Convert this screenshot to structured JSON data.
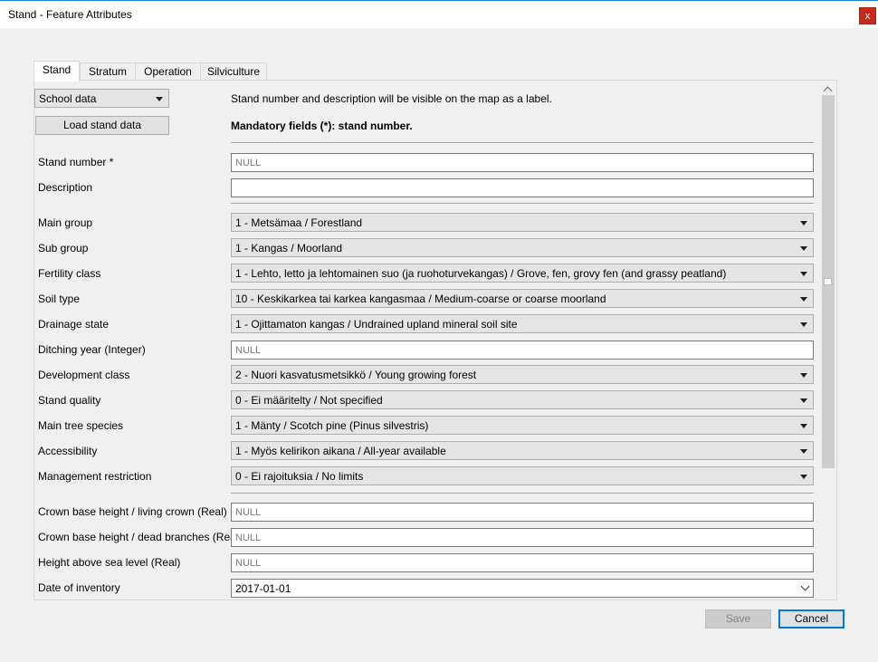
{
  "window": {
    "title": "Stand - Feature Attributes",
    "close_label": "x"
  },
  "tabs": [
    "Stand",
    "Stratum",
    "Operation",
    "Silviculture"
  ],
  "school_select": {
    "value": "School data"
  },
  "load_button": "Load stand data",
  "info": {
    "label_hint": "Stand number and description will be visible on the map as a label.",
    "mandatory": "Mandatory fields (*): stand number."
  },
  "fields": {
    "stand_number": {
      "label": "Stand number *",
      "placeholder": "NULL"
    },
    "description": {
      "label": "Description",
      "value": ""
    },
    "main_group": {
      "label": "Main group",
      "value": "1 - Metsämaa / Forestland"
    },
    "sub_group": {
      "label": "Sub group",
      "value": "1 - Kangas / Moorland"
    },
    "fertility_class": {
      "label": "Fertility class",
      "value": "1 - Lehto, letto ja lehtomainen suo (ja ruohoturvekangas) / Grove, fen, grovy fen (and grassy peatland)"
    },
    "soil_type": {
      "label": "Soil type",
      "value": "10 - Keskikarkea tai karkea kangasmaa / Medium-coarse or coarse moorland"
    },
    "drainage_state": {
      "label": "Drainage state",
      "value": "1 - Ojittamaton kangas / Undrained upland mineral soil site"
    },
    "ditching_year": {
      "label": "Ditching year (Integer)",
      "placeholder": "NULL"
    },
    "development_class": {
      "label": "Development class",
      "value": "2 - Nuori kasvatusmetsikkö / Young growing forest"
    },
    "stand_quality": {
      "label": "Stand quality",
      "value": "0 - Ei määritelty / Not specified"
    },
    "main_tree_species": {
      "label": "Main tree species",
      "value": "1 - Mänty / Scotch pine (Pinus silvestris)"
    },
    "accessibility": {
      "label": "Accessibility",
      "value": "1 - Myös kelirikon aikana / All-year available"
    },
    "management_restriction": {
      "label": "Management restriction",
      "value": "0 - Ei rajoituksia / No limits"
    },
    "crown_base_living": {
      "label": "Crown base height / living crown (Real)",
      "placeholder": "NULL"
    },
    "crown_base_dead": {
      "label": "Crown base height / dead branches (Real)",
      "placeholder": "NULL"
    },
    "height_above_sea": {
      "label": "Height above sea level (Real)",
      "placeholder": "NULL"
    },
    "date_of_inventory": {
      "label": "Date of inventory",
      "value": "2017-01-01"
    }
  },
  "buttons": {
    "save": "Save",
    "cancel": "Cancel"
  }
}
